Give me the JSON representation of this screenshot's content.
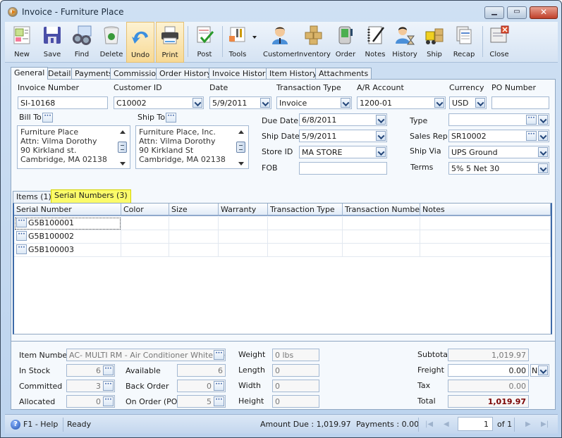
{
  "window": {
    "title": "Invoice - Furniture Place"
  },
  "toolbar": {
    "buttons": [
      {
        "label": "New",
        "icon": "new-document-icon"
      },
      {
        "label": "Save",
        "icon": "floppy-disk-icon"
      },
      {
        "label": "Find",
        "icon": "binoculars-icon"
      },
      {
        "label": "Delete",
        "icon": "recycle-bin-icon"
      },
      {
        "label": "Undo",
        "icon": "undo-arrow-icon"
      },
      {
        "label": "Print",
        "icon": "printer-icon"
      },
      {
        "label": "Post",
        "icon": "post-checkmark-icon"
      },
      {
        "label": "Tools",
        "icon": "tools-icon"
      },
      {
        "label": "Customer",
        "icon": "customer-person-icon"
      },
      {
        "label": "Inventory",
        "icon": "boxes-icon"
      },
      {
        "label": "Order",
        "icon": "pda-order-icon"
      },
      {
        "label": "Notes",
        "icon": "notepad-pen-icon"
      },
      {
        "label": "History",
        "icon": "person-hourglass-icon"
      },
      {
        "label": "Ship",
        "icon": "forklift-icon"
      },
      {
        "label": "Recap",
        "icon": "recap-sheets-icon"
      },
      {
        "label": "Close",
        "icon": "close-window-icon"
      }
    ]
  },
  "tabs": [
    "General",
    "Detail",
    "Payments",
    "Commission",
    "Order History",
    "Invoice History",
    "Item History",
    "Attachments"
  ],
  "header": {
    "invoice_number": {
      "label": "Invoice Number",
      "value": "SI-10168"
    },
    "customer_id": {
      "label": "Customer ID",
      "value": "C10002"
    },
    "date": {
      "label": "Date",
      "value": "5/9/2011"
    },
    "transaction_type": {
      "label": "Transaction Type",
      "value": "Invoice"
    },
    "ar_account": {
      "label": "A/R Account",
      "value": "1200-01"
    },
    "currency": {
      "label": "Currency",
      "value": "USD"
    },
    "po_number": {
      "label": "PO Number",
      "value": ""
    },
    "bill_to": {
      "label": "Bill To",
      "lines": "Furniture Place\nAttn: Vilma Dorothy\n90 Kirkland st.\nCambridge, MA 02138"
    },
    "ship_to": {
      "label": "Ship To",
      "lines": "Furniture Place, Inc.\nAttn: Vilma Dorothy\n90 Kirkland St\nCambridge, MA 02138"
    },
    "due_date": {
      "label": "Due Date",
      "value": "6/8/2011"
    },
    "ship_date": {
      "label": "Ship Date",
      "value": "5/9/2011"
    },
    "store_id": {
      "label": "Store ID",
      "value": "MA STORE"
    },
    "fob": {
      "label": "FOB",
      "value": ""
    },
    "type": {
      "label": "Type",
      "value": ""
    },
    "sales_rep": {
      "label": "Sales Rep",
      "value": "SR10002"
    },
    "ship_via": {
      "label": "Ship Via",
      "value": "UPS Ground"
    },
    "terms": {
      "label": "Terms",
      "value": "5% 5 Net 30"
    }
  },
  "subtabs": [
    "Items (1)",
    "Serial Numbers (3)"
  ],
  "grid": {
    "columns": [
      "Serial Number",
      "Color",
      "Size",
      "Warranty",
      "Transaction Type",
      "Transaction Number",
      "Notes"
    ],
    "rows": [
      [
        "G5B100001",
        "",
        "",
        "",
        "",
        "",
        ""
      ],
      [
        "G5B100002",
        "",
        "",
        "",
        "",
        "",
        ""
      ],
      [
        "G5B100003",
        "",
        "",
        "",
        "",
        "",
        ""
      ]
    ]
  },
  "item_info": {
    "item_number": {
      "label": "Item Number",
      "value": "AC- MULTI RM - Air Conditioner White Kenn"
    },
    "in_stock": {
      "label": "In Stock",
      "value": "6"
    },
    "committed": {
      "label": "Committed",
      "value": "3"
    },
    "allocated": {
      "label": "Allocated",
      "value": "0"
    },
    "available": {
      "label": "Available",
      "value": "6"
    },
    "back_order": {
      "label": "Back Order",
      "value": "0"
    },
    "on_order": {
      "label": "On Order (PO)",
      "value": "5"
    },
    "weight": {
      "label": "Weight",
      "value": "0 lbs"
    },
    "length": {
      "label": "Length",
      "value": "0"
    },
    "width": {
      "label": "Width",
      "value": "0"
    },
    "height": {
      "label": "Height",
      "value": "0"
    }
  },
  "totals": {
    "subtotal": {
      "label": "Subtotal",
      "value": "1,019.97"
    },
    "freight": {
      "label": "Freight",
      "value": "0.00",
      "option": "N"
    },
    "tax": {
      "label": "Tax",
      "value": "0.00"
    },
    "total": {
      "label": "Total",
      "value": "1,019.97",
      "color": "#7a0000"
    }
  },
  "status": {
    "help": "F1 - Help",
    "state": "Ready",
    "amount_due": "Amount Due : 1,019.97",
    "payments": "Payments : 0.00",
    "page": "1",
    "of": "of 1"
  }
}
